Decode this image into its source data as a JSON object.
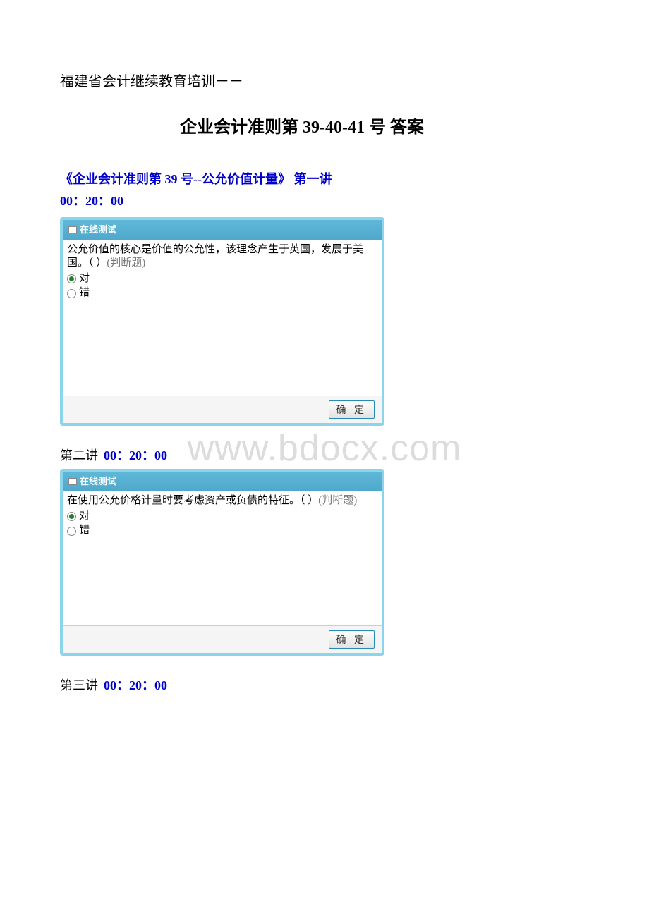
{
  "watermark": "www.bdocx.com",
  "intro": "福建省会计继续教育培训－－",
  "mainTitle": "企业会计准则第 39-40-41 号  答案",
  "sections": [
    {
      "label": "《企业会计准则第 39 号--公允价值计量》  第一讲",
      "time": "00：20：00",
      "quizHeader": "在线测试",
      "question": "公允价值的核心是价值的公允性，该理念产生于英国，发展于美国。（  ）",
      "questionType": "(判断题)",
      "optTrue": "对",
      "optFalse": "错",
      "confirm": "确 定"
    },
    {
      "prefix": "第二讲",
      "time": "00：20：00",
      "quizHeader": "在线测试",
      "question": "在使用公允价格计量时要考虑资产或负债的特征。（  ）",
      "questionType": "(判断题)",
      "optTrue": "对",
      "optFalse": "错",
      "confirm": "确 定"
    },
    {
      "prefix": "第三讲",
      "time": "00：20：00"
    }
  ]
}
